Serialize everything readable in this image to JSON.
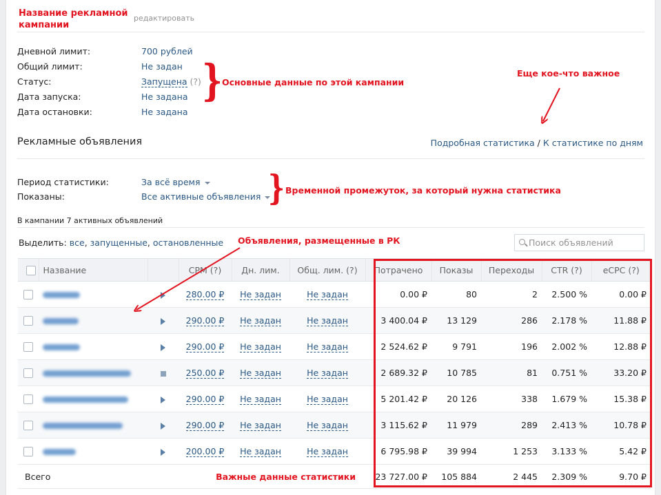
{
  "campaign": {
    "edit_label": "редактировать"
  },
  "info": {
    "rows": [
      {
        "label": "Дневной лимит:",
        "value": "700 рублей"
      },
      {
        "label": "Общий лимит:",
        "value": "Не задан"
      },
      {
        "label": "Статус:",
        "value": "Запущена",
        "hint": "(?)"
      },
      {
        "label": "Дата запуска:",
        "value": "Не задана"
      },
      {
        "label": "Дата остановки:",
        "value": "Не задана"
      }
    ]
  },
  "ads_section": {
    "title": "Рекламные объявления",
    "detailed_stats_link": "Подробная статистика",
    "separator": "/",
    "daily_stats_link": "К статистике по дням"
  },
  "filters": {
    "period_label": "Период статистики:",
    "period_value": "За всё время",
    "shown_label": "Показаны:",
    "shown_value": "Все активные объявления"
  },
  "summary": {
    "active_count_text": "В кампании 7 активных объявлений",
    "select_label": "Выделить:",
    "select_all": "все",
    "select_running": "запущенные",
    "select_stopped": "остановленные",
    "comma": ","
  },
  "search": {
    "placeholder": "Поиск объявлений"
  },
  "table": {
    "headers": {
      "name": "Название",
      "cpm": "CPM (?)",
      "day_limit": "Дн. лим.",
      "total_limit": "Общ. лим. (?)",
      "spent": "Потрачено",
      "impressions": "Показы",
      "clicks": "Переходы",
      "ctr": "CTR (?)",
      "ecpc": "eCPC (?)"
    },
    "rows": [
      {
        "status": "running",
        "cpm": "280.00 ₽",
        "day_limit": "Не задан",
        "total_limit": "Не задан",
        "spent": "0.00 ₽",
        "impressions": "80",
        "clicks": "2",
        "ctr": "2.500 %",
        "ecpc": "0.00 ₽"
      },
      {
        "status": "running",
        "cpm": "290.00 ₽",
        "day_limit": "Не задан",
        "total_limit": "Не задан",
        "spent": "3 400.04 ₽",
        "impressions": "13 129",
        "clicks": "286",
        "ctr": "2.178 %",
        "ecpc": "11.88 ₽"
      },
      {
        "status": "running",
        "cpm": "290.00 ₽",
        "day_limit": "Не задан",
        "total_limit": "Не задан",
        "spent": "2 524.62 ₽",
        "impressions": "9 791",
        "clicks": "196",
        "ctr": "2.002 %",
        "ecpc": "12.88 ₽"
      },
      {
        "status": "stopped",
        "cpm": "250.00 ₽",
        "day_limit": "Не задан",
        "total_limit": "Не задан",
        "spent": "2 689.32 ₽",
        "impressions": "10 785",
        "clicks": "81",
        "ctr": "0.751 %",
        "ecpc": "33.20 ₽"
      },
      {
        "status": "running",
        "cpm": "290.00 ₽",
        "day_limit": "Не задан",
        "total_limit": "Не задан",
        "spent": "5 201.42 ₽",
        "impressions": "20 126",
        "clicks": "338",
        "ctr": "1.679 %",
        "ecpc": "15.38 ₽"
      },
      {
        "status": "running",
        "cpm": "290.00 ₽",
        "day_limit": "Не задан",
        "total_limit": "Не задан",
        "spent": "3 115.62 ₽",
        "impressions": "11 979",
        "clicks": "289",
        "ctr": "2.413 %",
        "ecpc": "10.78 ₽"
      },
      {
        "status": "running",
        "cpm": "200.00 ₽",
        "day_limit": "Не задан",
        "total_limit": "Не задан",
        "spent": "6 795.98 ₽",
        "impressions": "39 994",
        "clicks": "1 253",
        "ctr": "3.133 %",
        "ecpc": "5.42 ₽"
      }
    ],
    "total": {
      "label": "Всего",
      "spent": "23 727.00 ₽",
      "impressions": "105 884",
      "clicks": "2 445",
      "ctr": "2.309 %",
      "ecpc": "9.70 ₽"
    }
  },
  "annotations": {
    "campaign_name": "Название рекламной кампании",
    "main_data": "Основные данные по этой кампании",
    "important": "Еще кое-что важное",
    "period": "Временной промежуток, за который нужна статистика",
    "ads_placed": "Объявления, размещенные в РК",
    "important_stats": "Важные данные статистики"
  },
  "colors": {
    "annotation": "#e2141f",
    "link": "#2a5885",
    "header_bg": "#f0f2f5"
  }
}
